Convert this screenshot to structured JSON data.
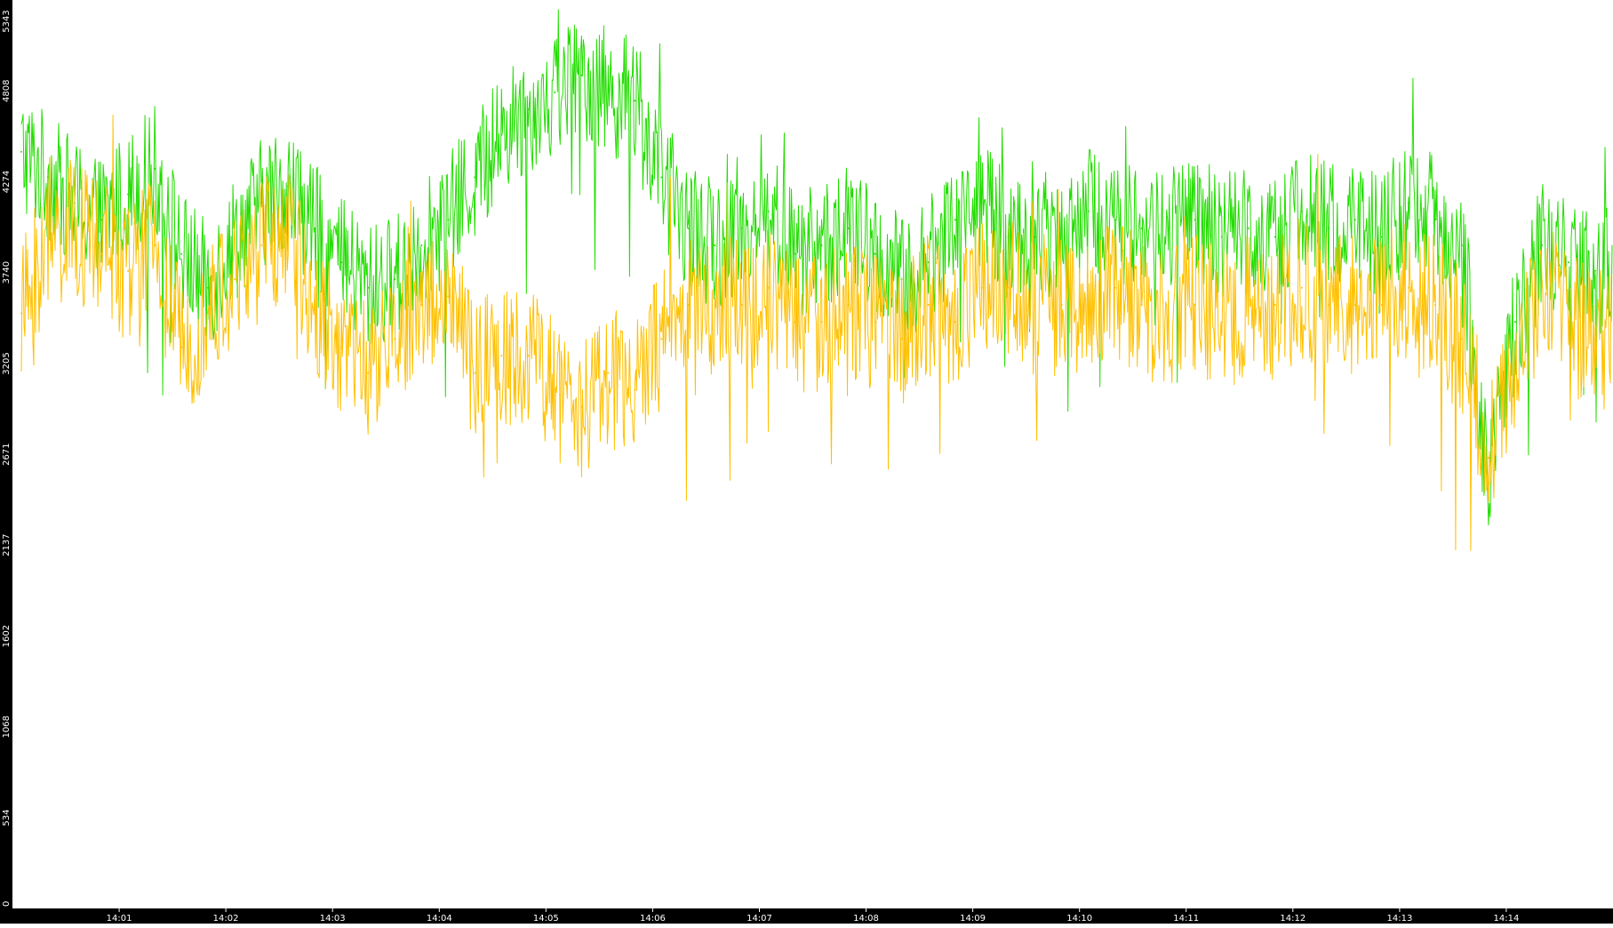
{
  "chart_data": {
    "type": "line",
    "title": "",
    "xlabel": "",
    "ylabel": "",
    "grid": false,
    "legend": "none",
    "y_ticks": [
      0,
      534,
      1068,
      1602,
      2137,
      2671,
      3205,
      3740,
      4274,
      4808,
      5343
    ],
    "y_tick_labels": [
      "0",
      "534",
      "1068",
      "1602",
      "2137",
      "2671",
      "3205",
      "3740",
      "4274",
      "4808",
      "5343"
    ],
    "ylim": [
      0,
      5343
    ],
    "x_ticks": [
      "14:01",
      "14:02",
      "14:03",
      "14:04",
      "14:05",
      "14:06",
      "14:07",
      "14:08",
      "14:09",
      "14:10",
      "14:11",
      "14:12",
      "14:13",
      "14:14"
    ],
    "x_start": "14:00:05",
    "x_end": "14:14:59",
    "series": [
      {
        "color": "#22dd00",
        "sample_interval_seconds": 15,
        "x": [
          "14:00:05",
          "14:00:20",
          "14:00:35",
          "14:00:50",
          "14:01:05",
          "14:01:20",
          "14:01:35",
          "14:01:50",
          "14:02:05",
          "14:02:20",
          "14:02:35",
          "14:02:50",
          "14:03:05",
          "14:03:20",
          "14:03:35",
          "14:03:50",
          "14:04:05",
          "14:04:20",
          "14:04:35",
          "14:04:50",
          "14:05:05",
          "14:05:20",
          "14:05:35",
          "14:05:50",
          "14:06:05",
          "14:06:20",
          "14:06:35",
          "14:06:50",
          "14:07:05",
          "14:07:20",
          "14:07:35",
          "14:07:50",
          "14:08:05",
          "14:08:20",
          "14:08:35",
          "14:08:50",
          "14:09:05",
          "14:09:20",
          "14:09:35",
          "14:09:50",
          "14:10:05",
          "14:10:20",
          "14:10:35",
          "14:10:50",
          "14:11:05",
          "14:11:20",
          "14:11:35",
          "14:11:50",
          "14:12:05",
          "14:12:20",
          "14:12:35",
          "14:12:50",
          "14:13:05",
          "14:13:20",
          "14:13:35",
          "14:13:50",
          "14:14:05",
          "14:14:20",
          "14:14:35",
          "14:14:50"
        ],
        "values": [
          4450,
          4300,
          4150,
          4050,
          4200,
          4350,
          3850,
          3650,
          3950,
          4150,
          4250,
          4000,
          3800,
          3650,
          3700,
          3900,
          4050,
          4300,
          4550,
          4700,
          4800,
          4900,
          4800,
          4750,
          4300,
          4000,
          3900,
          4000,
          4100,
          3850,
          3900,
          4000,
          3850,
          3700,
          3800,
          4050,
          4150,
          3950,
          3950,
          4000,
          4100,
          4050,
          4000,
          4000,
          4050,
          3950,
          4000,
          3950,
          4100,
          4000,
          4050,
          3950,
          4150,
          4050,
          3900,
          2500,
          3450,
          3900,
          3800,
          3750
        ]
      },
      {
        "color": "#ffc000",
        "sample_interval_seconds": 15,
        "x": [
          "14:00:05",
          "14:00:20",
          "14:00:35",
          "14:00:50",
          "14:01:05",
          "14:01:20",
          "14:01:35",
          "14:01:50",
          "14:02:05",
          "14:02:20",
          "14:02:35",
          "14:02:50",
          "14:03:05",
          "14:03:20",
          "14:03:35",
          "14:03:50",
          "14:04:05",
          "14:04:20",
          "14:04:35",
          "14:04:50",
          "14:05:05",
          "14:05:20",
          "14:05:35",
          "14:05:50",
          "14:06:05",
          "14:06:20",
          "14:06:35",
          "14:06:50",
          "14:07:05",
          "14:07:20",
          "14:07:35",
          "14:07:50",
          "14:08:05",
          "14:08:20",
          "14:08:35",
          "14:08:50",
          "14:09:05",
          "14:09:20",
          "14:09:35",
          "14:09:50",
          "14:10:05",
          "14:10:20",
          "14:10:35",
          "14:10:50",
          "14:11:05",
          "14:11:20",
          "14:11:35",
          "14:11:50",
          "14:12:05",
          "14:12:20",
          "14:12:35",
          "14:12:50",
          "14:13:05",
          "14:13:20",
          "14:13:35",
          "14:13:50",
          "14:14:05",
          "14:14:20",
          "14:14:35",
          "14:14:50"
        ],
        "values": [
          3500,
          3900,
          4000,
          3850,
          3750,
          3900,
          3300,
          3500,
          3700,
          3900,
          3950,
          3550,
          3300,
          3150,
          3350,
          3550,
          3600,
          3150,
          3250,
          3250,
          3050,
          2950,
          3150,
          3050,
          3350,
          3550,
          3550,
          3550,
          3650,
          3450,
          3450,
          3550,
          3450,
          3350,
          3550,
          3450,
          3650,
          3650,
          3550,
          3550,
          3550,
          3650,
          3550,
          3450,
          3550,
          3450,
          3550,
          3550,
          3650,
          3550,
          3550,
          3550,
          3650,
          3550,
          3350,
          2650,
          3150,
          3650,
          3450,
          3350
        ]
      }
    ]
  }
}
